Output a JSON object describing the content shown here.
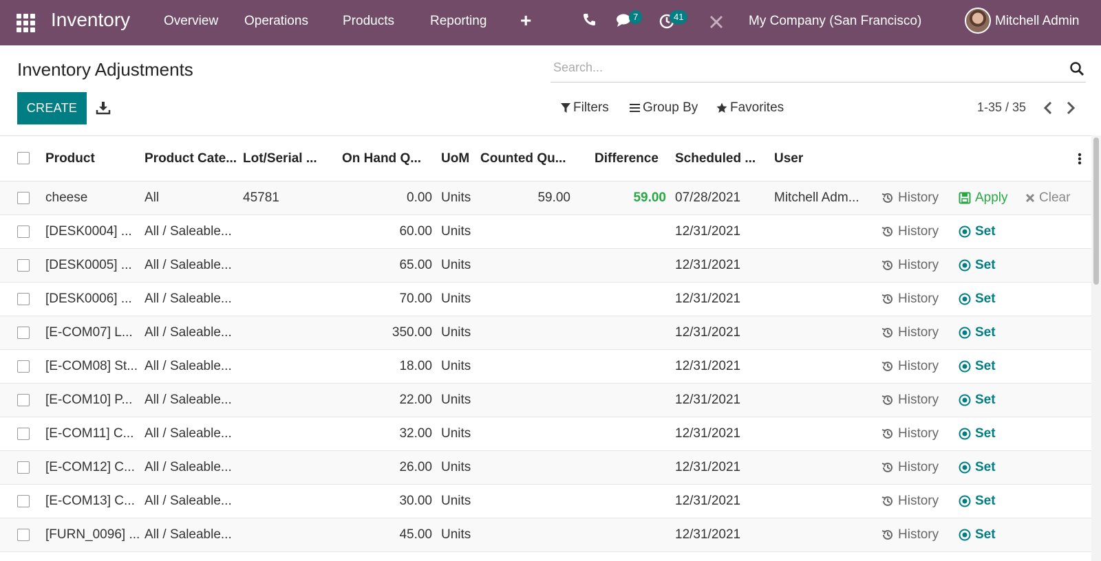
{
  "navbar": {
    "app_name": "Inventory",
    "menu": [
      "Overview",
      "Operations",
      "Products",
      "Reporting"
    ],
    "plus": "+",
    "chat_count": "7",
    "activity_count": "41",
    "company": "My Company (San Francisco)",
    "user": "Mitchell Admin"
  },
  "control_panel": {
    "title": "Inventory Adjustments",
    "search_placeholder": "Search...",
    "create_label": "CREATE",
    "filters_label": "Filters",
    "group_by_label": "Group By",
    "favorites_label": "Favorites",
    "pager": "1-35 / 35"
  },
  "table": {
    "headers": {
      "product": "Product",
      "category": "Product Cate...",
      "lot": "Lot/Serial ...",
      "on_hand": "On Hand Q...",
      "uom": "UoM",
      "counted": "Counted Qu...",
      "difference": "Difference",
      "scheduled": "Scheduled ...",
      "user": "User"
    },
    "action_labels": {
      "history": "History",
      "apply": "Apply",
      "clear": "Clear",
      "set": "Set"
    },
    "rows": [
      {
        "product": "cheese",
        "category": "All",
        "lot": "45781",
        "on_hand": "0.00",
        "uom": "Units",
        "counted": "59.00",
        "difference": "59.00",
        "scheduled": "07/28/2021",
        "user": "Mitchell Adm...",
        "mode": "apply"
      },
      {
        "product": "[DESK0004] ...",
        "category": "All / Saleable...",
        "lot": "",
        "on_hand": "60.00",
        "uom": "Units",
        "counted": "",
        "difference": "",
        "scheduled": "12/31/2021",
        "user": "",
        "mode": "set"
      },
      {
        "product": "[DESK0005] ...",
        "category": "All / Saleable...",
        "lot": "",
        "on_hand": "65.00",
        "uom": "Units",
        "counted": "",
        "difference": "",
        "scheduled": "12/31/2021",
        "user": "",
        "mode": "set"
      },
      {
        "product": "[DESK0006] ...",
        "category": "All / Saleable...",
        "lot": "",
        "on_hand": "70.00",
        "uom": "Units",
        "counted": "",
        "difference": "",
        "scheduled": "12/31/2021",
        "user": "",
        "mode": "set"
      },
      {
        "product": "[E-COM07] L...",
        "category": "All / Saleable...",
        "lot": "",
        "on_hand": "350.00",
        "uom": "Units",
        "counted": "",
        "difference": "",
        "scheduled": "12/31/2021",
        "user": "",
        "mode": "set"
      },
      {
        "product": "[E-COM08] St...",
        "category": "All / Saleable...",
        "lot": "",
        "on_hand": "18.00",
        "uom": "Units",
        "counted": "",
        "difference": "",
        "scheduled": "12/31/2021",
        "user": "",
        "mode": "set"
      },
      {
        "product": "[E-COM10] P...",
        "category": "All / Saleable...",
        "lot": "",
        "on_hand": "22.00",
        "uom": "Units",
        "counted": "",
        "difference": "",
        "scheduled": "12/31/2021",
        "user": "",
        "mode": "set"
      },
      {
        "product": "[E-COM11] C...",
        "category": "All / Saleable...",
        "lot": "",
        "on_hand": "32.00",
        "uom": "Units",
        "counted": "",
        "difference": "",
        "scheduled": "12/31/2021",
        "user": "",
        "mode": "set"
      },
      {
        "product": "[E-COM12] C...",
        "category": "All / Saleable...",
        "lot": "",
        "on_hand": "26.00",
        "uom": "Units",
        "counted": "",
        "difference": "",
        "scheduled": "12/31/2021",
        "user": "",
        "mode": "set"
      },
      {
        "product": "[E-COM13] C...",
        "category": "All / Saleable...",
        "lot": "",
        "on_hand": "30.00",
        "uom": "Units",
        "counted": "",
        "difference": "",
        "scheduled": "12/31/2021",
        "user": "",
        "mode": "set"
      },
      {
        "product": "[FURN_0096] ...",
        "category": "All / Saleable...",
        "lot": "",
        "on_hand": "45.00",
        "uom": "Units",
        "counted": "",
        "difference": "",
        "scheduled": "12/31/2021",
        "user": "",
        "mode": "set"
      }
    ]
  },
  "colors": {
    "navbar": "#714b67",
    "primary": "#017e84",
    "success": "#28a745"
  }
}
